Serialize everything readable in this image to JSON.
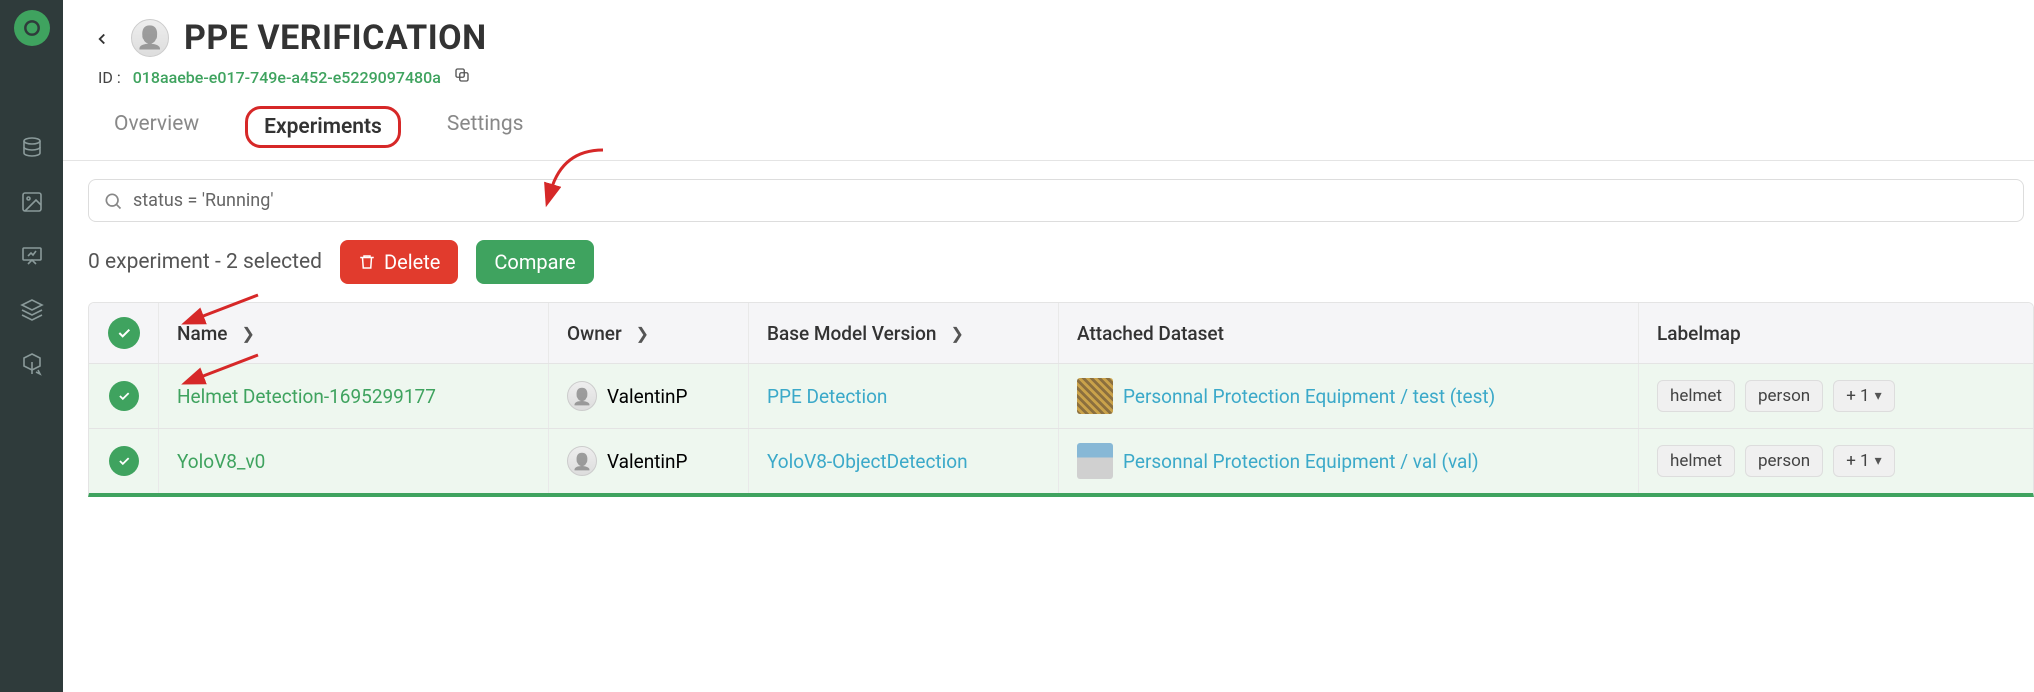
{
  "page": {
    "title": "PPE VERIFICATION",
    "id_label": "ID :",
    "id_value": "018aaebe-e017-749e-a452-e5229097480a"
  },
  "tabs": {
    "overview": "Overview",
    "experiments": "Experiments",
    "settings": "Settings"
  },
  "search": {
    "value": "status = 'Running'"
  },
  "toolbar": {
    "summary": "0 experiment - 2 selected",
    "delete": "Delete",
    "compare": "Compare"
  },
  "columns": {
    "name": "Name",
    "owner": "Owner",
    "model": "Base Model Version",
    "dataset": "Attached Dataset",
    "labelmap": "Labelmap"
  },
  "rows": [
    {
      "name": "Helmet Detection-1695299177",
      "owner": "ValentinP",
      "model": "PPE Detection",
      "dataset": "Personnal Protection Equipment / test (test)",
      "labels": {
        "a": "helmet",
        "b": "person",
        "more": "+ 1"
      }
    },
    {
      "name": "YoloV8_v0",
      "owner": "ValentinP",
      "model": "YoloV8-ObjectDetection",
      "dataset": "Personnal Protection Equipment / val (val)",
      "labels": {
        "a": "helmet",
        "b": "person",
        "more": "+ 1"
      }
    }
  ]
}
